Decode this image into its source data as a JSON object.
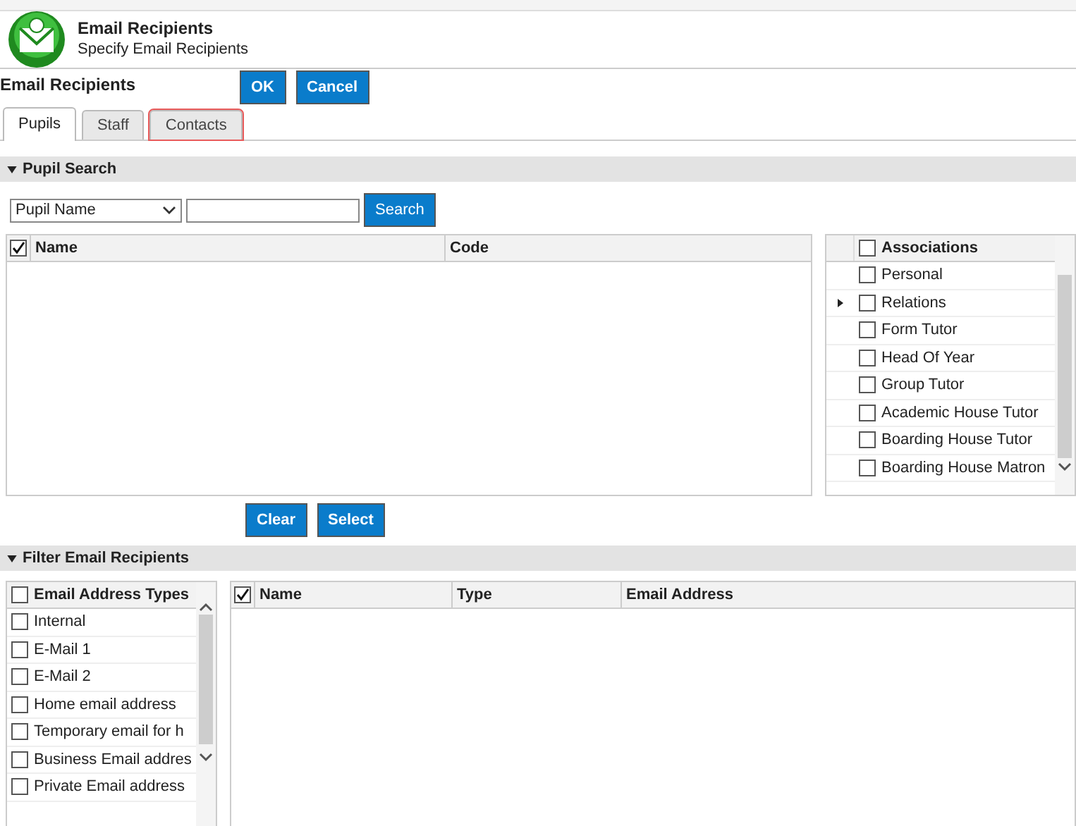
{
  "header": {
    "title": "Email Recipients",
    "subtitle": "Specify Email Recipients"
  },
  "toolbar": {
    "title": "Email Recipients",
    "buttons": [
      "OK",
      "Cancel"
    ]
  },
  "tabs": [
    {
      "label": "Pupils",
      "selected": true,
      "focused": false
    },
    {
      "label": "Staff",
      "selected": false,
      "focused": false
    },
    {
      "label": "Contacts",
      "selected": false,
      "focused": true
    }
  ],
  "pupil_search": {
    "title": "Pupil Search",
    "search_by": "Pupil Name",
    "search_button": "Search",
    "grid": {
      "columns": [
        {
          "label": "Name"
        },
        {
          "label": "Code"
        }
      ],
      "all_checked": true
    },
    "associations": {
      "title": "Associations",
      "all_checked": false,
      "rows": [
        {
          "label": "Personal",
          "checked": false,
          "expandable": false
        },
        {
          "label": "Relations",
          "checked": false,
          "expandable": true
        },
        {
          "label": "Form Tutor",
          "checked": false,
          "expandable": false
        },
        {
          "label": "Head Of Year",
          "checked": false,
          "expandable": false
        },
        {
          "label": "Group Tutor",
          "checked": false,
          "expandable": false
        },
        {
          "label": "Academic House Tutor",
          "checked": false,
          "expandable": false
        },
        {
          "label": "Boarding House Tutor",
          "checked": false,
          "expandable": false
        },
        {
          "label": "Boarding House Matron",
          "checked": false,
          "expandable": false
        }
      ]
    },
    "buttons": [
      "Clear",
      "Select"
    ]
  },
  "filter": {
    "title": "Filter Email Recipients",
    "address_types": {
      "title": "Email Address Types",
      "all_checked": false,
      "rows": [
        {
          "label": "Internal",
          "checked": false
        },
        {
          "label": "E-Mail 1",
          "checked": false
        },
        {
          "label": "E-Mail 2",
          "checked": false
        },
        {
          "label": "Home email address",
          "checked": false
        },
        {
          "label": "Temporary email for h",
          "checked": false
        },
        {
          "label": "Business Email addres",
          "checked": false
        },
        {
          "label": "Private Email address",
          "checked": false
        }
      ]
    },
    "grid": {
      "all_checked": true,
      "columns": [
        {
          "label": "Name"
        },
        {
          "label": "Type"
        },
        {
          "label": "Email Address"
        }
      ]
    }
  }
}
